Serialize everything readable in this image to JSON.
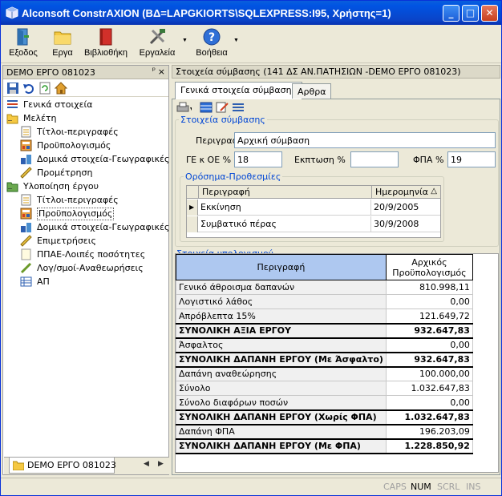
{
  "window": {
    "title": "Alconsoft ConstrAXION  (ΒΔ=LAPGKIORTS\\SQLEXPRESS:I95, Χρήστης=1)",
    "min": "_",
    "max": "□",
    "close": "✕"
  },
  "toolbar": {
    "exit": "Εξοδος",
    "projects": "Εργα",
    "library": "Βιβλιοθήκη",
    "tools": "Εργαλεία",
    "help": "Βοήθεια"
  },
  "left": {
    "header": "DEMO ΕΡΓΟ 081023",
    "pin": "ᵖ",
    "close": "×",
    "tree": [
      {
        "label": "Γενικά στοιχεία",
        "level": 0,
        "icon": "list-icon"
      },
      {
        "label": "Μελέτη",
        "level": 0,
        "icon": "folder-open-icon"
      },
      {
        "label": "Τίτλοι-περιγραφές",
        "level": 1,
        "icon": "document-icon"
      },
      {
        "label": "Προϋπολογισμός",
        "level": 1,
        "icon": "calculator-icon"
      },
      {
        "label": "Δομικά στοιχεία-Γεωγραφικές πε",
        "level": 1,
        "icon": "structure-icon"
      },
      {
        "label": "Προμέτρηση",
        "level": 1,
        "icon": "ruler-icon"
      },
      {
        "label": "Υλοποίηση έργου",
        "level": 0,
        "icon": "folder-build-icon"
      },
      {
        "label": "Τίτλοι-περιγραφές",
        "level": 1,
        "icon": "document-icon"
      },
      {
        "label": "Προϋπολογισμός",
        "level": 1,
        "icon": "calculator-icon",
        "selected": true
      },
      {
        "label": "Δομικά στοιχεία-Γεωγραφικές πε",
        "level": 1,
        "icon": "structure-icon"
      },
      {
        "label": "Επιμετρήσεις",
        "level": 1,
        "icon": "ruler-icon"
      },
      {
        "label": "ΠΠΑΕ-Λοιπές ποσότητες",
        "level": 1,
        "icon": "page-icon"
      },
      {
        "label": "Λογ/σμοί-Αναθεωρήσεις",
        "level": 1,
        "icon": "pencil-icon"
      },
      {
        "label": "ΑΠ",
        "level": 1,
        "icon": "grid-icon"
      }
    ],
    "footer_tab": "DEMO ΕΡΓΟ 081023",
    "nav_prev": "◀",
    "nav_next": "▶"
  },
  "right": {
    "header": "Στοιχεία σύμβασης (141 ΔΣ ΑΝ.ΠΑΤΗΣΙΩΝ -DEMO ΕΡΓΟ 081023)",
    "tabs": [
      "Γενικά στοιχεία σύμβασης",
      "Αρθρα"
    ],
    "contract": {
      "legend": "Στοιχεία σύμβασης",
      "desc_label": "Περιγραφή",
      "desc_value": "Αρχική σύμβαση",
      "ge_label": "ΓΕ κ ΟΕ %",
      "ge_value": "18",
      "discount_label": "Εκπτωση %",
      "discount_value": "",
      "vat_label": "ΦΠΑ %",
      "vat_value": "19"
    },
    "deadlines": {
      "legend": "Ορόσημα-Προθεσμίες",
      "col_desc": "Περιγραφή",
      "col_date": "Ημερομηνία",
      "sort": "△",
      "rows": [
        {
          "desc": "Εκκίνηση",
          "date": "20/9/2005",
          "current": "▶"
        },
        {
          "desc": "Συμβατικό πέρας",
          "date": "30/9/2008",
          "current": ""
        }
      ]
    },
    "calc": {
      "legend": "Στοιχεία υπολογισμού",
      "col_desc": "Περιγραφή",
      "col_initial_1": "Αρχικός",
      "col_initial_2": "Προϋπολογισμός",
      "rows": [
        {
          "label": "Γενικό άθροισμα δαπανών",
          "value": "810.998,11",
          "bold": false
        },
        {
          "label": "Λογιστικό λάθος",
          "value": "0,00",
          "bold": false
        },
        {
          "label": "Απρόβλεπτα 15%",
          "value": "121.649,72",
          "bold": false
        },
        {
          "label": "ΣΥΝΟΛΙΚΗ ΑΞΙΑ ΕΡΓΟΥ",
          "value": "932.647,83",
          "bold": true
        },
        {
          "label": "Άσφαλτος",
          "value": "0,00",
          "bold": false
        },
        {
          "label": "ΣΥΝΟΛΙΚΗ ΔΑΠΑΝΗ ΕΡΓΟΥ (Με Άσφαλτο)",
          "value": "932.647,83",
          "bold": true
        },
        {
          "label": "Δαπάνη αναθεώρησης",
          "value": "100.000,00",
          "bold": false
        },
        {
          "label": "Σύνολο",
          "value": "1.032.647,83",
          "bold": false
        },
        {
          "label": "Σύνολο διαφόρων ποσών",
          "value": "0,00",
          "bold": false
        },
        {
          "label": "ΣΥΝΟΛΙΚΗ ΔΑΠΑΝΗ ΕΡΓΟΥ (Χωρίς ΦΠΑ)",
          "value": "1.032.647,83",
          "bold": true
        },
        {
          "label": "Δαπάνη ΦΠΑ",
          "value": "196.203,09",
          "bold": false
        },
        {
          "label": "ΣΥΝΟΛΙΚΗ ΔΑΠΑΝΗ ΕΡΓΟΥ (Με ΦΠΑ)",
          "value": "1.228.850,92",
          "bold": true
        }
      ]
    }
  },
  "status": {
    "caps": "CAPS",
    "num": "NUM",
    "scrl": "SCRL",
    "ins": "INS"
  }
}
